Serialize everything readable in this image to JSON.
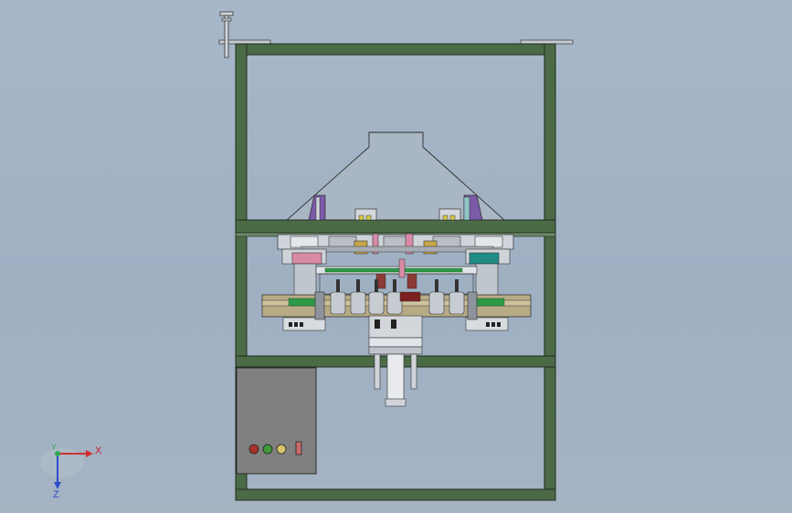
{
  "viewport": {
    "background_top": "#a7b7c9",
    "background_bottom": "#a5b3c3"
  },
  "model": {
    "frame_color": "#4b6b46",
    "frame_edge_color": "#1f2b1d",
    "hood_color": "#a9b6c4",
    "base_plate_color": "#c6ccd3",
    "rail_color": "#b7ab86",
    "pink_block_color": "#d98aa4",
    "teal_block_color": "#1f8c86",
    "purple_part_color": "#7b5aa8",
    "green_bar_color": "#2e9a48"
  },
  "control_box": {
    "color": "#808080",
    "buttons": [
      {
        "name": "red-indicator",
        "color": "#a8322b"
      },
      {
        "name": "green-indicator",
        "color": "#3f9a3a"
      },
      {
        "name": "yellow-indicator",
        "color": "#d5c46a"
      }
    ],
    "switch_color": "#c86a6a"
  },
  "triad": {
    "x_label": "X",
    "y_label": "Y",
    "z_label": "Z",
    "x_color": "#d23030",
    "y_color": "#2fa84f",
    "z_color": "#2e4cc9"
  }
}
